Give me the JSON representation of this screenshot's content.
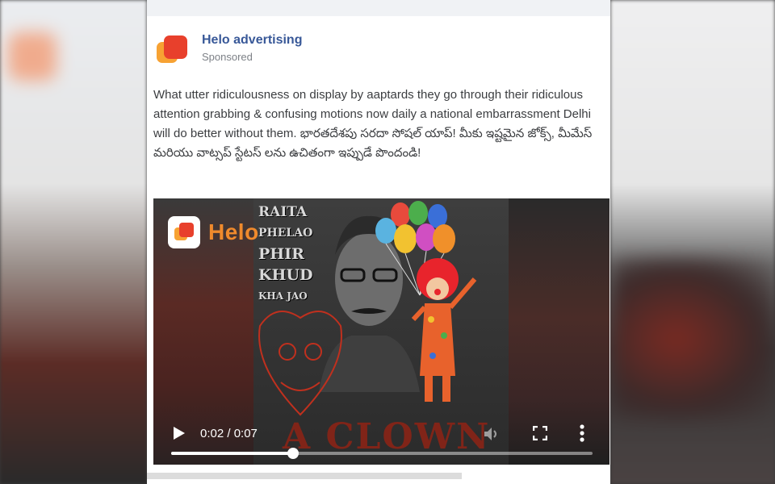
{
  "post": {
    "page_name": "Helo advertising",
    "sponsored_label": "Sponsored",
    "body_text": "What utter ridiculousness on display by aaptards they go through their ridiculous attention grabbing & confusing motions now daily a national embarrassment Delhi will do better without them. భారతదేశపు సరదా సోషల్ యాప్! మీకు ఇష్టమైన జోక్స్, మీమేస్ మరియు వాట్సప్ స్టేటస్ లను ఉచితంగా ఇప్పుడే పొందండి!",
    "logo_icon": "helo-logo-icon"
  },
  "video": {
    "watermark": "Helo",
    "overlay_lines": [
      "RAITA",
      "PHELAO",
      "PHIR",
      "KHUD",
      "KHA JAO"
    ],
    "caption_art": "A CLOWN",
    "controls": {
      "time": "0:02 / 0:07",
      "progress_fraction": 0.29,
      "play_icon": "play-icon",
      "volume_icon": "volume-icon",
      "fullscreen_icon": "fullscreen-icon",
      "more_icon": "more-vertical-icon"
    }
  },
  "colors": {
    "link_blue": "#385898",
    "helo_orange": "#f7a233",
    "helo_red": "#e8402c"
  }
}
